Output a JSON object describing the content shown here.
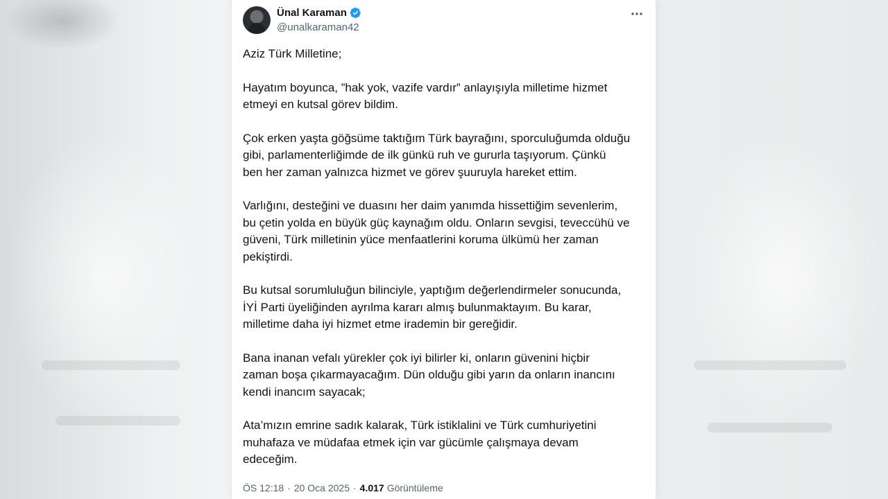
{
  "tweet": {
    "author_name": "Ünal Karaman",
    "author_handle": "@unalkaraman42",
    "paragraphs": [
      "Aziz Türk Milletine;",
      "Hayatım boyunca, ”hak yok, vazife vardır” anlayışıyla milletime hizmet\netmeyi en kutsal görev bildim.",
      "Çok erken yaşta göğsüme taktığım Türk bayrağını, sporculuğumda olduğu\ngibi, parlamenterliğimde de ilk günkü ruh ve gururla taşıyorum. Çünkü\nben her zaman yalnızca hizmet ve görev şuuruyla hareket ettim.",
      "Varlığını, desteğini ve duasını her daim yanımda hissettiğim sevenlerim,\nbu çetin yolda en büyük güç kaynağım oldu. Onların sevgisi, teveccühü ve\ngüveni, Türk milletinin yüce menfaatlerini koruma ülkümü her zaman\npekiştirdi.",
      "Bu kutsal sorumluluğun bilinciyle, yaptığım değerlendirmeler sonucunda,\nİYİ Parti üyeliğinden ayrılma kararı almış bulunmaktayım. Bu karar,\nmilletime daha iyi hizmet etme irademin bir gereğidir.",
      "Bana inanan vefalı yürekler çok iyi bilirler ki, onların güvenini hiçbir\nzaman boşa çıkarmayacağım. Dün olduğu gibi yarın da onların inancını\nkendi inancım sayacak;",
      "Ata’mızın emrine sadık kalarak, Türk istiklalini ve Türk cumhuriyetini\nmuhafaza ve müdafaa etmek için var gücümle çalışmaya devam\nedeceğim."
    ],
    "time": "ÖS 12:18",
    "date": "20 Oca 2025",
    "separator": "·",
    "views_count": "4.017",
    "views_label": "Görüntüleme"
  },
  "colors": {
    "text": "#0f1419",
    "secondary": "#536471",
    "verified": "#1d9bf0"
  },
  "icons": {
    "verified": "verified-badge-icon",
    "more": "more-options-icon"
  }
}
